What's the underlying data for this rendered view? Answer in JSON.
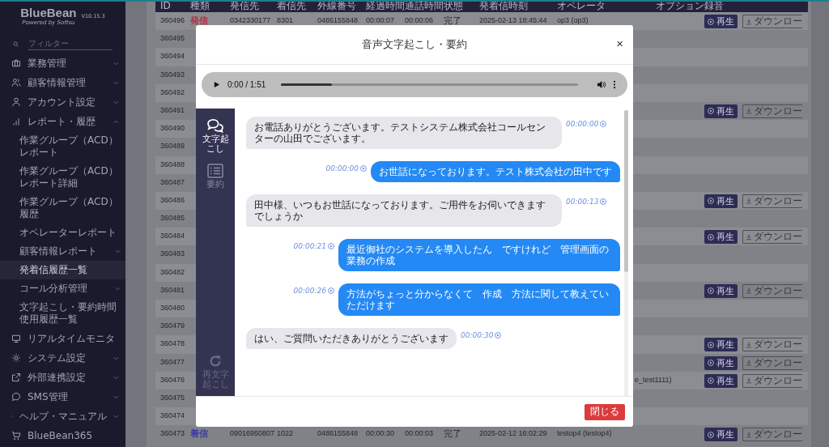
{
  "sidebar": {
    "logo": "BlueBean",
    "tagline": "Powered by Softsu",
    "version": "V10.15.3",
    "filter": {
      "placeholder": "フィルター"
    },
    "items": [
      {
        "label": "業務管理",
        "selected": false,
        "expanded": false
      },
      {
        "label": "顧客情報管理",
        "selected": false,
        "expanded": false
      },
      {
        "label": "アカウント設定",
        "selected": false,
        "expanded": false
      },
      {
        "label": "レポート・履歴",
        "selected": false,
        "expanded": true,
        "children": [
          {
            "label": "作業グループ（ACD）レポート",
            "selected": false
          },
          {
            "label": "作業グループ（ACD）レポート詳細",
            "selected": false
          },
          {
            "label": "作業グループ（ACD）履歴",
            "selected": false
          },
          {
            "label": "オペレーターレポート",
            "selected": false
          },
          {
            "label": "顧客情報レポート",
            "selected": false,
            "expanded": false
          },
          {
            "label": "発着信履歴一覧",
            "selected": true
          },
          {
            "label": "コール分析管理",
            "selected": false,
            "expanded": false
          },
          {
            "label": "文字起こし・要約時間使用履歴一覧",
            "selected": false
          }
        ]
      },
      {
        "label": "リアルタイムモニタ",
        "selected": false
      },
      {
        "label": "システム設定",
        "selected": false,
        "expanded": false
      },
      {
        "label": "外部連携設定",
        "selected": false,
        "expanded": false
      },
      {
        "label": "SMS管理",
        "selected": false,
        "expanded": false
      },
      {
        "label": "ヘルプ・マニュアル",
        "selected": false,
        "expanded": false
      },
      {
        "label": "BlueBean365",
        "selected": false
      }
    ]
  },
  "table": {
    "columns": [
      "ID",
      "種類",
      "発信先",
      "着信先",
      "外線番号",
      "経過時間",
      "通話時間",
      "状態",
      "発着信時刻",
      "オペレータ",
      "オプション",
      "録音"
    ],
    "rows": [
      {
        "id": "360496",
        "type": {
          "label": "発信",
          "color": "#b03040"
        },
        "from": "0342330177",
        "to": "8301",
        "line": "0486155848",
        "elapsed": "00:00:07",
        "talk": "00:00:06",
        "status": "完了",
        "time": "2025-02-13 18:45:44",
        "operator": "op3 (op3)",
        "play": "再生",
        "download": "ダウンロー"
      },
      {
        "id": "360495"
      },
      {
        "id": "360494"
      },
      {
        "id": "360493"
      },
      {
        "id": "360492"
      },
      {
        "id": "360491",
        "play": "再生",
        "download": "ダウンロー"
      },
      {
        "id": "360490"
      },
      {
        "id": "360489"
      },
      {
        "id": "360488"
      },
      {
        "id": "360487"
      },
      {
        "id": "360486",
        "play": "再生",
        "download": "ダウンロー"
      },
      {
        "id": "360485"
      },
      {
        "id": "360484",
        "play": "再生",
        "download": "ダウンロー"
      },
      {
        "id": "360483"
      },
      {
        "id": "360482"
      },
      {
        "id": "360481",
        "play": "再生",
        "download": "ダウンロー"
      },
      {
        "id": "360480"
      },
      {
        "id": "360479"
      },
      {
        "id": "360478",
        "play": "再生",
        "download": "ダウンロー"
      },
      {
        "id": "360477",
        "play": "再生",
        "download": "ダウンロー"
      },
      {
        "id": "360476",
        "operator_tail": "e_test1111)",
        "play": "再生",
        "download": "ダウンロー"
      },
      {
        "id": "360475"
      },
      {
        "id": "360474"
      },
      {
        "id": "360473",
        "type": {
          "label": "着信",
          "color": "#3a3aa8"
        },
        "from": "09016950807",
        "to": "1022",
        "line": "0486155848",
        "elapsed": "00:00:30",
        "talk": "00:00:03",
        "status": "完了",
        "time": "2025-02-12 16:02:29",
        "operator": "testop4 (testop4)",
        "play": "再生",
        "download": "ダウンロー"
      }
    ]
  },
  "modal": {
    "title": "音声文字起こし・要約",
    "close": "×",
    "audio": {
      "time": "0:00 / 1:51",
      "level": 0.17
    },
    "tabs": [
      {
        "label": "文字起こし",
        "selected": true
      },
      {
        "label": "要約",
        "selected": false
      }
    ],
    "redo": {
      "label": "再文字起こし",
      "disabled": true
    },
    "messages": [
      {
        "kind": "incoming",
        "text": "お電話ありがとうございます。テストシステム株式会社コールセンターの山田でございます。",
        "time": "00:00:00"
      },
      {
        "kind": "outgoing",
        "text": "お世話になっております。テスト株式会社の田中です",
        "time": "00:00:00"
      },
      {
        "kind": "incoming",
        "text": "田中様、いつもお世話になっております。ご用件をお伺いできますでしょうか",
        "time": "00:00:13"
      },
      {
        "kind": "outgoing",
        "text": "最近御社のシステムを導入したん　ですけれど　管理画面の業務の作成",
        "time": "00:00:21"
      },
      {
        "kind": "outgoing",
        "text": "方法がちょっと分からなくて　作成　方法に関して教えていただけます",
        "time": "00:00:26"
      },
      {
        "kind": "incoming",
        "text": "はい、ご質問いただきありがとうございます",
        "time": "00:00:30"
      }
    ],
    "footer": {
      "close": "閉じる"
    }
  }
}
